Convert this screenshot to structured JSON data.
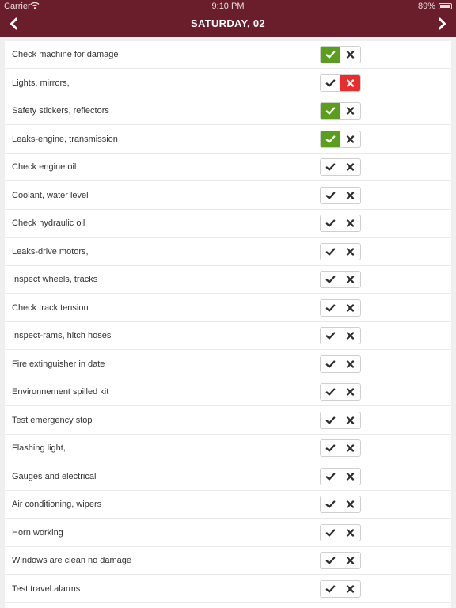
{
  "status_bar": {
    "carrier": "Carrier",
    "time": "9:10 PM",
    "battery": "89%"
  },
  "nav": {
    "title": "SATURDAY,  02",
    "back_icon": "chevron-left-icon",
    "forward_icon": "chevron-right-icon"
  },
  "colors": {
    "header": "#6a1d2a",
    "ok": "#5a9f1c",
    "fail": "#ec2c2c"
  },
  "items": [
    {
      "label": "Check machine for damage",
      "state": "ok"
    },
    {
      "label": "Lights, mirrors,",
      "state": "fail"
    },
    {
      "label": "Safety stickers, reflectors",
      "state": "ok"
    },
    {
      "label": "Leaks-engine, transmission",
      "state": "ok"
    },
    {
      "label": "Check engine oil",
      "state": "none"
    },
    {
      "label": "Coolant, water level",
      "state": "none"
    },
    {
      "label": "Check hydraulic oil",
      "state": "none"
    },
    {
      "label": "Leaks-drive motors,",
      "state": "none"
    },
    {
      "label": "Inspect wheels, tracks",
      "state": "none"
    },
    {
      "label": "Check track tension",
      "state": "none"
    },
    {
      "label": "Inspect-rams, hitch hoses",
      "state": "none"
    },
    {
      "label": "Fire extinguisher in date",
      "state": "none"
    },
    {
      "label": "Environnement spilled kit",
      "state": "none"
    },
    {
      "label": "Test emergency stop",
      "state": "none"
    },
    {
      "label": "Flashing light,",
      "state": "none"
    },
    {
      "label": "Gauges and electrical",
      "state": "none"
    },
    {
      "label": "Air conditioning, wipers",
      "state": "none"
    },
    {
      "label": "Horn working",
      "state": "none"
    },
    {
      "label": "Windows are clean no damage",
      "state": "none"
    },
    {
      "label": "Test travel alarms",
      "state": "none"
    }
  ]
}
